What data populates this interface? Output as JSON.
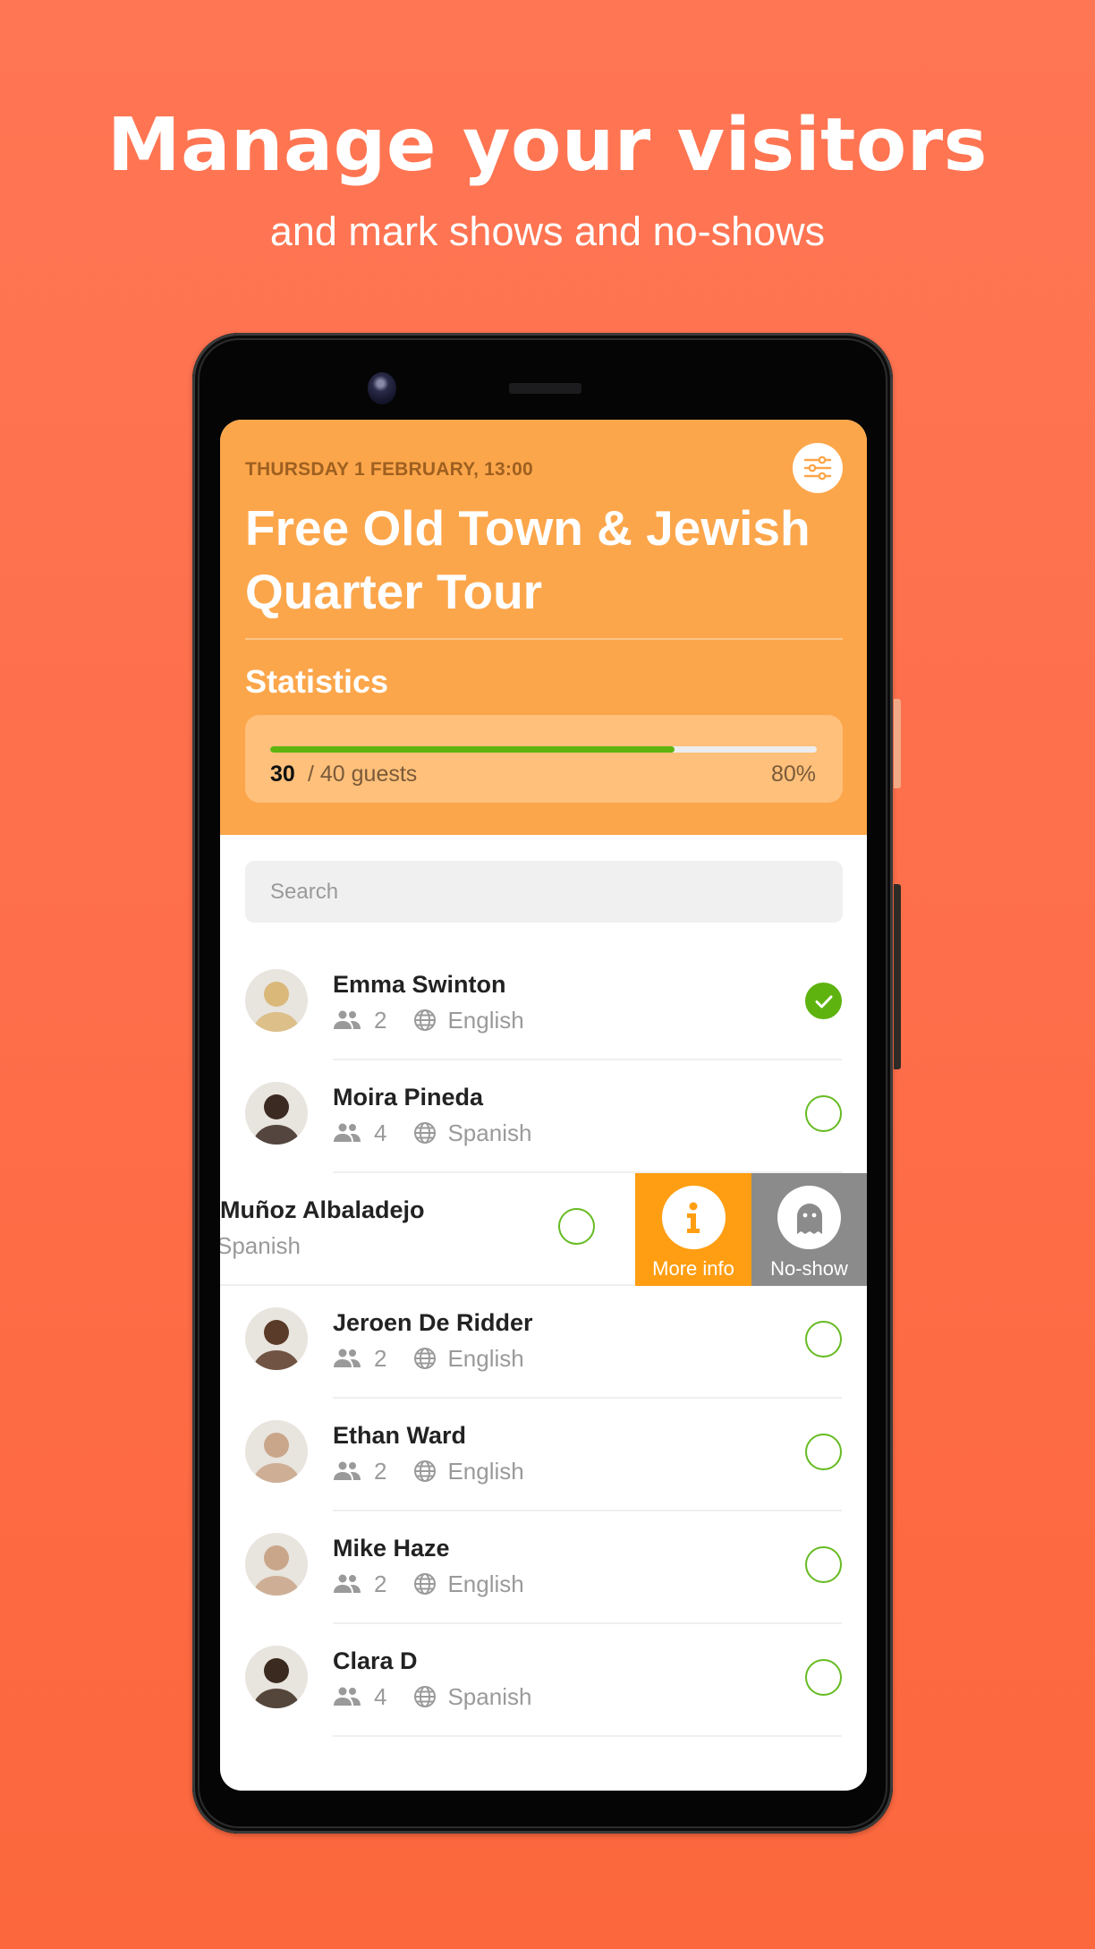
{
  "promo": {
    "headline": "Manage your visitors",
    "subline": "and mark shows and no-shows",
    "background_top": "#FF7654",
    "background_bottom": "#FC673D"
  },
  "header": {
    "date": "THURSDAY 1 FEBRUARY, 13:00",
    "title": "Free Old Town & Jewish Quarter Tour",
    "filter_icon": "sliders-icon",
    "accent_color": "#FCA64B"
  },
  "statistics": {
    "label": "Statistics",
    "checked_in": "30",
    "total_label": "/ 40 guests",
    "percent_label": "80%",
    "bar_fill_fraction": 0.74,
    "bar_color": "#5EB30F"
  },
  "search": {
    "placeholder": "Search",
    "value": ""
  },
  "guests": [
    {
      "name": "Emma Swinton",
      "group_size": "2",
      "language": "English",
      "checked_in": true,
      "avatar_color": "#D9B87A"
    },
    {
      "name": "Moira Pineda",
      "group_size": "4",
      "language": "Spanish",
      "checked_in": false,
      "avatar_color": "#3A2A22"
    },
    {
      "name": "Muñoz Albaladejo",
      "language": "Spanish",
      "checked_in": false,
      "swiped": true
    },
    {
      "name": "Jeroen De Ridder",
      "group_size": "2",
      "language": "English",
      "checked_in": false,
      "avatar_color": "#5A3A28"
    },
    {
      "name": "Ethan Ward",
      "group_size": "2",
      "language": "English",
      "checked_in": false,
      "avatar_color": "#C9A68A"
    },
    {
      "name": "Mike Haze",
      "group_size": "2",
      "language": "English",
      "checked_in": false,
      "avatar_color": "#C9A68A"
    },
    {
      "name": "Clara D",
      "group_size": "4",
      "language": "Spanish",
      "checked_in": false,
      "avatar_color": "#3B2A20"
    }
  ],
  "swipe_actions": {
    "more_info": {
      "label": "More info",
      "icon": "info-icon",
      "color": "#FF9E12"
    },
    "no_show": {
      "label": "No-show",
      "icon": "ghost-icon",
      "color": "#8B8B8B"
    }
  },
  "status_colors": {
    "checked": "#5EB30F",
    "unchecked_ring": "#66BB22"
  }
}
